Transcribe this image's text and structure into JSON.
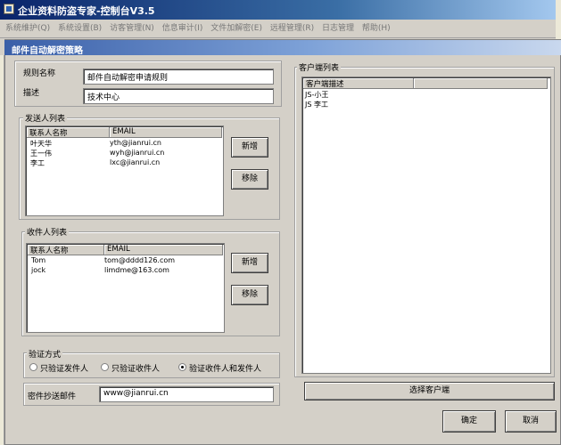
{
  "window": {
    "title": "企业资料防盗专家-控制台V3.5"
  },
  "menu": [
    "系统维护(Q)",
    "系统设置(B)",
    "访客管理(N)",
    "信息审计(I)",
    "文件加解密(E)",
    "远程管理(R)",
    "日志管理",
    "帮助(H)"
  ],
  "dialog": {
    "title": "邮件自动解密策略",
    "rule_name_label": "规则名称",
    "rule_name_value": "邮件自动解密申请规则",
    "desc_label": "描述",
    "desc_value": "技术中心",
    "senders": {
      "title": "发送人列表",
      "headers": [
        "联系人名称",
        "EMAIL"
      ],
      "rows": [
        {
          "name": "叶天华",
          "email": "yth@jianrui.cn"
        },
        {
          "name": "王一伟",
          "email": "wyh@jianrui.cn"
        },
        {
          "name": "李工",
          "email": "lxc@jianrui.cn"
        }
      ],
      "add_label": "新增",
      "remove_label": "移除"
    },
    "receivers": {
      "title": "收件人列表",
      "headers": [
        "联系人名称",
        "EMAIL"
      ],
      "rows": [
        {
          "name": "Tom",
          "email": "tom@dddd126.com"
        },
        {
          "name": "jock",
          "email": "limdme@163.com"
        }
      ],
      "add_label": "新增",
      "remove_label": "移除"
    },
    "verify": {
      "title": "验证方式",
      "options": [
        "只验证发件人",
        "只验证收件人",
        "验证收件人和发件人"
      ],
      "selected_index": 2
    },
    "copy_label": "密件抄送邮件",
    "copy_value": "www@jianrui.cn",
    "clients": {
      "title": "客户端列表",
      "header": "客户端描述",
      "rows": [
        "JS-小王",
        "JS 李工"
      ]
    },
    "select_client_label": "选择客户端",
    "ok_label": "确定",
    "cancel_label": "取消"
  }
}
